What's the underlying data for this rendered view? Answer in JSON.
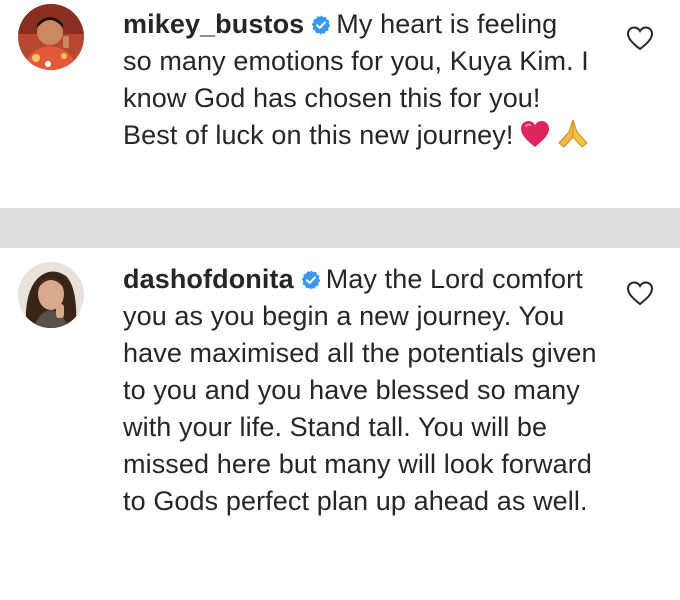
{
  "comments": [
    {
      "username": "mikey_bustos",
      "verified": true,
      "text": "My heart is feeling so many emotions for you, Kuya Kim. I know God has chosen this for you! Best of luck on this new journey!",
      "emojis": [
        "red-heart",
        "folded-hands"
      ]
    },
    {
      "username": "dashofdonita",
      "verified": true,
      "text": "May the Lord comfort you as you begin a new journey. You have maximised all the potentials given to you and you have blessed so many with your life. Stand tall. You will be missed here but many will look forward to Gods perfect plan up ahead as well."
    }
  ],
  "icons": {
    "verified": "verified-badge-icon",
    "like": "heart-outline-icon"
  },
  "colors": {
    "verified_blue": "#3897f0",
    "heart_red": "#e0245e",
    "divider_gray": "#dcdcdc",
    "text": "#262626"
  }
}
